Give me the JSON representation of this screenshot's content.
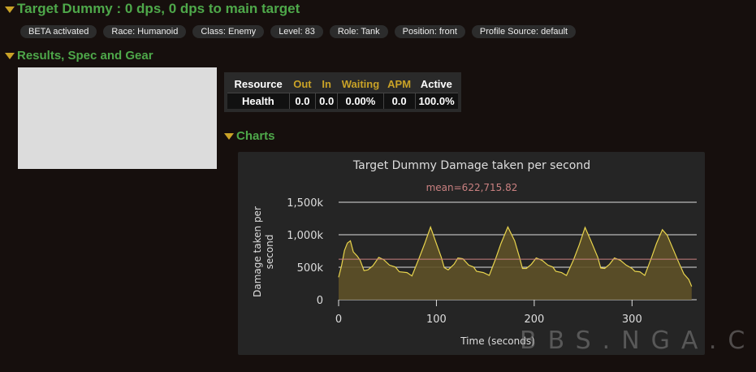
{
  "header": {
    "title": "Target Dummy : 0 dps, 0 dps to main target"
  },
  "tags": [
    "BETA activated",
    "Race: Humanoid",
    "Class: Enemy",
    "Level: 83",
    "Role: Tank",
    "Position: front",
    "Profile Source: default"
  ],
  "results": {
    "title": "Results, Spec and Gear"
  },
  "resource_table": {
    "headers": [
      "Resource",
      "Out",
      "In",
      "Waiting",
      "APM",
      "Active"
    ],
    "rows": [
      [
        "Health",
        "0.0",
        "0.0",
        "0.00%",
        "0.0",
        "100.0%"
      ]
    ]
  },
  "charts": {
    "title": "Charts"
  },
  "watermark": "BBS.NGA.CN",
  "chart_data": {
    "type": "area",
    "title": "Target Dummy Damage taken per second",
    "annotation": "mean=622,715.82",
    "mean": 622715.82,
    "xlabel": "Time (seconds)",
    "ylabel": "Damage taken per second",
    "xlim": [
      0,
      362
    ],
    "ylim": [
      0,
      1500000
    ],
    "xticks": [
      "0",
      "100",
      "200",
      "300"
    ],
    "xtick_values": [
      0,
      100,
      200,
      300
    ],
    "yticks": [
      "0",
      "500k",
      "1,000k",
      "1,500k"
    ],
    "ytick_values": [
      0,
      500000,
      1000000,
      1500000
    ],
    "grid": true,
    "colors": {
      "line": "#e8d44d",
      "fill": "#5e5128",
      "mean": "#c98080"
    },
    "x": [
      0,
      3,
      6,
      9,
      12,
      15,
      19,
      22,
      26,
      30,
      35,
      41,
      46,
      52,
      58,
      62,
      70,
      75,
      82,
      88,
      94,
      100,
      105,
      108,
      112,
      118,
      122,
      127,
      133,
      138,
      141,
      148,
      154,
      160,
      166,
      173,
      180,
      185,
      188,
      192,
      197,
      202,
      208,
      214,
      219,
      222,
      228,
      233,
      240,
      246,
      252,
      258,
      265,
      268,
      272,
      277,
      282,
      288,
      294,
      300,
      303,
      308,
      313,
      320,
      325,
      331,
      336,
      342,
      348,
      353,
      358,
      361
    ],
    "y": [
      345,
      523,
      757,
      872,
      906,
      736,
      672,
      608,
      447,
      460,
      523,
      651,
      617,
      532,
      502,
      430,
      417,
      366,
      630,
      864,
      1119,
      864,
      651,
      494,
      460,
      545,
      643,
      630,
      532,
      502,
      438,
      417,
      374,
      608,
      864,
      1119,
      906,
      651,
      481,
      481,
      545,
      643,
      608,
      532,
      502,
      438,
      417,
      374,
      608,
      843,
      1111,
      906,
      651,
      489,
      481,
      545,
      643,
      608,
      532,
      481,
      438,
      430,
      374,
      651,
      864,
      1077,
      991,
      779,
      566,
      396,
      311,
      204
    ],
    "y_unit": "k"
  }
}
